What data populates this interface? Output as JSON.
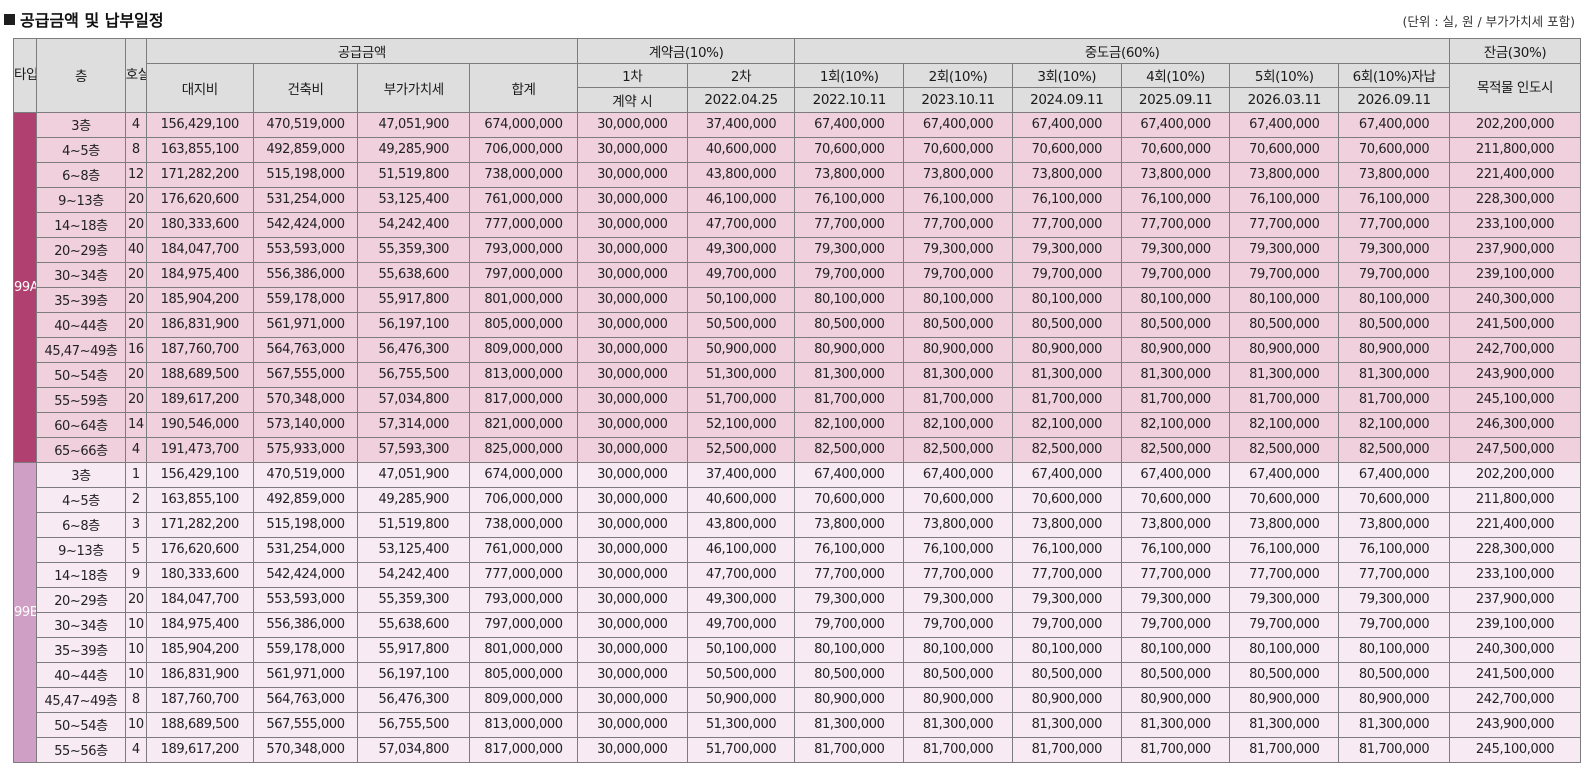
{
  "title": "공급금액 및 납부일정",
  "unit_note": "(단위 : 실, 원 / 부가가치세 포함)",
  "headers": {
    "type": "타입",
    "floor": "층",
    "units": "호실수",
    "supply": "공급금액",
    "land": "대지비",
    "building": "건축비",
    "vat": "부가가치세",
    "total": "합계",
    "deposit": "계약금(10%)",
    "deposit_1": "1차",
    "deposit_1_date": "계약 시",
    "deposit_2": "2차",
    "deposit_2_date": "2022.04.25",
    "middle": "중도금(60%)",
    "mid_labels": [
      "1회(10%)",
      "2회(10%)",
      "3회(10%)",
      "4회(10%)",
      "5회(10%)",
      "6회(10%)자납"
    ],
    "mid_dates": [
      "2022.10.11",
      "2023.10.11",
      "2024.09.11",
      "2025.09.11",
      "2026.03.11",
      "2026.09.11"
    ],
    "balance": "잔금(30%)",
    "balance_sub": "목적물 인도시"
  },
  "groups": [
    {
      "type": "99A",
      "rows": [
        [
          "3층",
          "4",
          "156,429,100",
          "470,519,000",
          "47,051,900",
          "674,000,000",
          "30,000,000",
          "37,400,000",
          "67,400,000",
          "67,400,000",
          "67,400,000",
          "67,400,000",
          "67,400,000",
          "67,400,000",
          "202,200,000"
        ],
        [
          "4~5층",
          "8",
          "163,855,100",
          "492,859,000",
          "49,285,900",
          "706,000,000",
          "30,000,000",
          "40,600,000",
          "70,600,000",
          "70,600,000",
          "70,600,000",
          "70,600,000",
          "70,600,000",
          "70,600,000",
          "211,800,000"
        ],
        [
          "6~8층",
          "12",
          "171,282,200",
          "515,198,000",
          "51,519,800",
          "738,000,000",
          "30,000,000",
          "43,800,000",
          "73,800,000",
          "73,800,000",
          "73,800,000",
          "73,800,000",
          "73,800,000",
          "73,800,000",
          "221,400,000"
        ],
        [
          "9~13층",
          "20",
          "176,620,600",
          "531,254,000",
          "53,125,400",
          "761,000,000",
          "30,000,000",
          "46,100,000",
          "76,100,000",
          "76,100,000",
          "76,100,000",
          "76,100,000",
          "76,100,000",
          "76,100,000",
          "228,300,000"
        ],
        [
          "14~18층",
          "20",
          "180,333,600",
          "542,424,000",
          "54,242,400",
          "777,000,000",
          "30,000,000",
          "47,700,000",
          "77,700,000",
          "77,700,000",
          "77,700,000",
          "77,700,000",
          "77,700,000",
          "77,700,000",
          "233,100,000"
        ],
        [
          "20~29층",
          "40",
          "184,047,700",
          "553,593,000",
          "55,359,300",
          "793,000,000",
          "30,000,000",
          "49,300,000",
          "79,300,000",
          "79,300,000",
          "79,300,000",
          "79,300,000",
          "79,300,000",
          "79,300,000",
          "237,900,000"
        ],
        [
          "30~34층",
          "20",
          "184,975,400",
          "556,386,000",
          "55,638,600",
          "797,000,000",
          "30,000,000",
          "49,700,000",
          "79,700,000",
          "79,700,000",
          "79,700,000",
          "79,700,000",
          "79,700,000",
          "79,700,000",
          "239,100,000"
        ],
        [
          "35~39층",
          "20",
          "185,904,200",
          "559,178,000",
          "55,917,800",
          "801,000,000",
          "30,000,000",
          "50,100,000",
          "80,100,000",
          "80,100,000",
          "80,100,000",
          "80,100,000",
          "80,100,000",
          "80,100,000",
          "240,300,000"
        ],
        [
          "40~44층",
          "20",
          "186,831,900",
          "561,971,000",
          "56,197,100",
          "805,000,000",
          "30,000,000",
          "50,500,000",
          "80,500,000",
          "80,500,000",
          "80,500,000",
          "80,500,000",
          "80,500,000",
          "80,500,000",
          "241,500,000"
        ],
        [
          "45,47~49층",
          "16",
          "187,760,700",
          "564,763,000",
          "56,476,300",
          "809,000,000",
          "30,000,000",
          "50,900,000",
          "80,900,000",
          "80,900,000",
          "80,900,000",
          "80,900,000",
          "80,900,000",
          "80,900,000",
          "242,700,000"
        ],
        [
          "50~54층",
          "20",
          "188,689,500",
          "567,555,000",
          "56,755,500",
          "813,000,000",
          "30,000,000",
          "51,300,000",
          "81,300,000",
          "81,300,000",
          "81,300,000",
          "81,300,000",
          "81,300,000",
          "81,300,000",
          "243,900,000"
        ],
        [
          "55~59층",
          "20",
          "189,617,200",
          "570,348,000",
          "57,034,800",
          "817,000,000",
          "30,000,000",
          "51,700,000",
          "81,700,000",
          "81,700,000",
          "81,700,000",
          "81,700,000",
          "81,700,000",
          "81,700,000",
          "245,100,000"
        ],
        [
          "60~64층",
          "14",
          "190,546,000",
          "573,140,000",
          "57,314,000",
          "821,000,000",
          "30,000,000",
          "52,100,000",
          "82,100,000",
          "82,100,000",
          "82,100,000",
          "82,100,000",
          "82,100,000",
          "82,100,000",
          "246,300,000"
        ],
        [
          "65~66층",
          "4",
          "191,473,700",
          "575,933,000",
          "57,593,300",
          "825,000,000",
          "30,000,000",
          "52,500,000",
          "82,500,000",
          "82,500,000",
          "82,500,000",
          "82,500,000",
          "82,500,000",
          "82,500,000",
          "247,500,000"
        ]
      ]
    },
    {
      "type": "99B",
      "rows": [
        [
          "3층",
          "1",
          "156,429,100",
          "470,519,000",
          "47,051,900",
          "674,000,000",
          "30,000,000",
          "37,400,000",
          "67,400,000",
          "67,400,000",
          "67,400,000",
          "67,400,000",
          "67,400,000",
          "67,400,000",
          "202,200,000"
        ],
        [
          "4~5층",
          "2",
          "163,855,100",
          "492,859,000",
          "49,285,900",
          "706,000,000",
          "30,000,000",
          "40,600,000",
          "70,600,000",
          "70,600,000",
          "70,600,000",
          "70,600,000",
          "70,600,000",
          "70,600,000",
          "211,800,000"
        ],
        [
          "6~8층",
          "3",
          "171,282,200",
          "515,198,000",
          "51,519,800",
          "738,000,000",
          "30,000,000",
          "43,800,000",
          "73,800,000",
          "73,800,000",
          "73,800,000",
          "73,800,000",
          "73,800,000",
          "73,800,000",
          "221,400,000"
        ],
        [
          "9~13층",
          "5",
          "176,620,600",
          "531,254,000",
          "53,125,400",
          "761,000,000",
          "30,000,000",
          "46,100,000",
          "76,100,000",
          "76,100,000",
          "76,100,000",
          "76,100,000",
          "76,100,000",
          "76,100,000",
          "228,300,000"
        ],
        [
          "14~18층",
          "9",
          "180,333,600",
          "542,424,000",
          "54,242,400",
          "777,000,000",
          "30,000,000",
          "47,700,000",
          "77,700,000",
          "77,700,000",
          "77,700,000",
          "77,700,000",
          "77,700,000",
          "77,700,000",
          "233,100,000"
        ],
        [
          "20~29층",
          "20",
          "184,047,700",
          "553,593,000",
          "55,359,300",
          "793,000,000",
          "30,000,000",
          "49,300,000",
          "79,300,000",
          "79,300,000",
          "79,300,000",
          "79,300,000",
          "79,300,000",
          "79,300,000",
          "237,900,000"
        ],
        [
          "30~34층",
          "10",
          "184,975,400",
          "556,386,000",
          "55,638,600",
          "797,000,000",
          "30,000,000",
          "49,700,000",
          "79,700,000",
          "79,700,000",
          "79,700,000",
          "79,700,000",
          "79,700,000",
          "79,700,000",
          "239,100,000"
        ],
        [
          "35~39층",
          "10",
          "185,904,200",
          "559,178,000",
          "55,917,800",
          "801,000,000",
          "30,000,000",
          "50,100,000",
          "80,100,000",
          "80,100,000",
          "80,100,000",
          "80,100,000",
          "80,100,000",
          "80,100,000",
          "240,300,000"
        ],
        [
          "40~44층",
          "10",
          "186,831,900",
          "561,971,000",
          "56,197,100",
          "805,000,000",
          "30,000,000",
          "50,500,000",
          "80,500,000",
          "80,500,000",
          "80,500,000",
          "80,500,000",
          "80,500,000",
          "80,500,000",
          "241,500,000"
        ],
        [
          "45,47~49층",
          "8",
          "187,760,700",
          "564,763,000",
          "56,476,300",
          "809,000,000",
          "30,000,000",
          "50,900,000",
          "80,900,000",
          "80,900,000",
          "80,900,000",
          "80,900,000",
          "80,900,000",
          "80,900,000",
          "242,700,000"
        ],
        [
          "50~54층",
          "10",
          "188,689,500",
          "567,555,000",
          "56,755,500",
          "813,000,000",
          "30,000,000",
          "51,300,000",
          "81,300,000",
          "81,300,000",
          "81,300,000",
          "81,300,000",
          "81,300,000",
          "81,300,000",
          "243,900,000"
        ],
        [
          "55~56층",
          "4",
          "189,617,200",
          "570,348,000",
          "57,034,800",
          "817,000,000",
          "30,000,000",
          "51,700,000",
          "81,700,000",
          "81,700,000",
          "81,700,000",
          "81,700,000",
          "81,700,000",
          "81,700,000",
          "245,100,000"
        ]
      ]
    }
  ]
}
